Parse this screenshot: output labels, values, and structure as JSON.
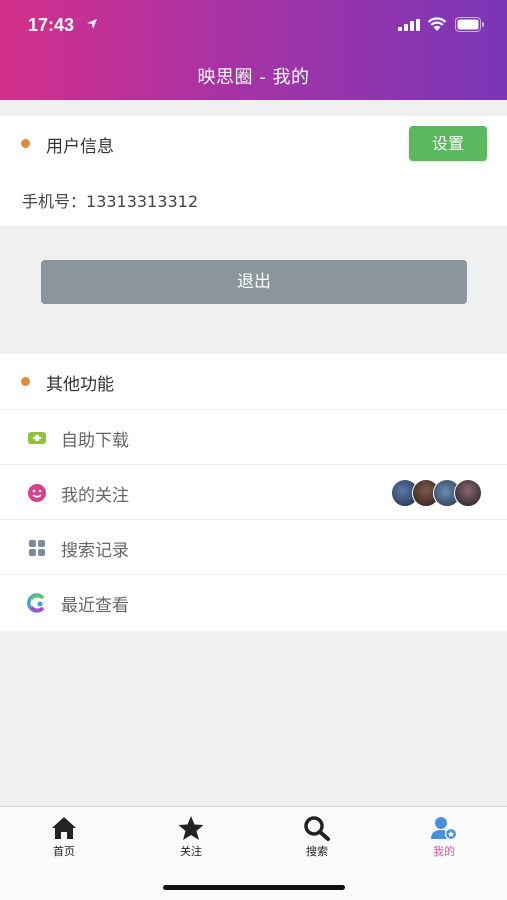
{
  "status_bar": {
    "time": "17:43"
  },
  "header": {
    "title": "映思圈 - 我的"
  },
  "user_info": {
    "title": "用户信息",
    "settings_label": "设置",
    "phone_label": "手机号：",
    "phone_value": "13313313312"
  },
  "logout_label": "退出",
  "functions": {
    "title": "其他功能",
    "items": [
      {
        "label": "自助下载",
        "icon": "download-icon"
      },
      {
        "label": "我的关注",
        "icon": "smile-icon"
      },
      {
        "label": "搜索记录",
        "icon": "grid-icon"
      },
      {
        "label": "最近查看",
        "icon": "colorful-c-icon"
      }
    ]
  },
  "tabbar": {
    "tabs": [
      {
        "label": "首页",
        "icon": "home-icon"
      },
      {
        "label": "关注",
        "icon": "star-icon"
      },
      {
        "label": "搜索",
        "icon": "search-icon"
      },
      {
        "label": "我的",
        "icon": "user-icon",
        "active": true
      }
    ]
  },
  "colors": {
    "header_gradient": [
      "#d42f8a",
      "#7a36b6"
    ],
    "settings_button": "#5cb85c",
    "logout_button": "#8b969c",
    "active_tab": "#e0559b",
    "section_dot": "#e08a3c"
  }
}
